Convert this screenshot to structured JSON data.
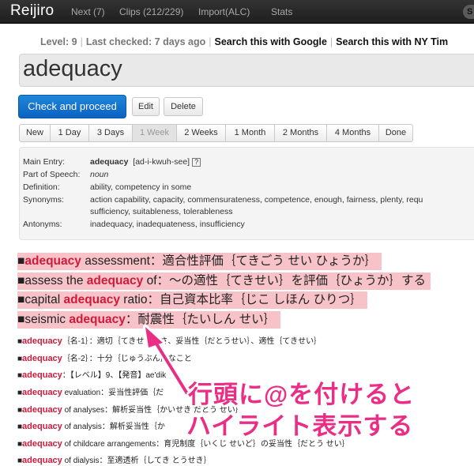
{
  "app": {
    "brand": "Reijiro",
    "nav": [
      {
        "label": "Next (7)"
      },
      {
        "label": "Clips (212/229)"
      },
      {
        "label": "Import(ALC)"
      },
      {
        "label": "Stats"
      }
    ],
    "user_badge": "S"
  },
  "info": {
    "level": "Level: 9",
    "last_checked": "Last checked: 7 days ago",
    "google": "Search this with Google",
    "nyt": "Search this with NY Tim"
  },
  "word": "adequacy",
  "actions": {
    "check": "Check and proceed",
    "edit": "Edit",
    "delete": "Delete"
  },
  "intervals": [
    "New",
    "1 Day",
    "3 Days",
    "1 Week",
    "2 Weeks",
    "1 Month",
    "2 Months",
    "4 Months",
    "Done"
  ],
  "active_interval": "1 Week",
  "definition": {
    "main_entry_label": "Main Entry:",
    "main_entry_word": "adequacy",
    "pronunciation": "[ad-i-kwuh-see]",
    "help": "?",
    "pos_label": "Part of Speech:",
    "pos": "noun",
    "def_label": "Definition:",
    "def": "ability, competency in some",
    "syn_label": "Synonyms:",
    "syn_line1": "action capability, capacity, commensurateness, competence, enough, fairness, plenty, requ",
    "syn_line2": "sufficiency, suitableness, tolerableness",
    "ant_label": "Antonyms:",
    "ant": "inadequacy, inadequateness, insufficiency"
  },
  "highlighted": [
    {
      "pre": "■",
      "kw": "adequacy",
      "post": " assessment：適合性評価｛てきごう せい ひょうか｝"
    },
    {
      "pre": "■assess the ",
      "kw": "adequacy",
      "post": " of：～の適性｛てきせい｝を評価｛ひょうか｝する"
    },
    {
      "pre": "■capital ",
      "kw": "adequacy",
      "post": " ratio：自己資本比率｛じこ しほん ひりつ｝"
    },
    {
      "pre": "■seismic ",
      "kw": "adequacy",
      "post": "：耐震性｛たいしん せい｝"
    }
  ],
  "entries": [
    {
      "pre": "■",
      "kw": "adequacy",
      "post": "｛名-1｝：適切｛てきせつ｝さ、妥当性｛だとうせい｝、適性｛てきせい｝"
    },
    {
      "pre": "■",
      "kw": "adequacy",
      "post": "｛名-2｝：十分｛じゅうぶん｝なこと"
    },
    {
      "pre": "■",
      "kw": "adequacy",
      "post": "：【レベル】9、【発音】ae'dik"
    },
    {
      "pre": "■",
      "kw": "adequacy",
      "post": " evaluation：妥当性評価｛だ"
    },
    {
      "pre": "■",
      "kw": "adequacy",
      "post": " of analyses：解析妥当性｛かいせき だとう せい｝"
    },
    {
      "pre": "■",
      "kw": "adequacy",
      "post": " of analysis：解析妥当性｛か"
    },
    {
      "pre": "■",
      "kw": "adequacy",
      "post": " of childcare arrangements：育児制度｛いくじ せいど｝の妥当性｛だとう せい｝"
    },
    {
      "pre": "■",
      "kw": "adequacy",
      "post": " of dialysis：至適透析｛してき とうせき｝"
    }
  ],
  "annotation": {
    "line1": "行頭に@を付けると",
    "line2": "ハイライト表示する",
    "color": "#ea2d85"
  },
  "colors": {
    "highlight_bg": "#f7c3c9",
    "keyword": "#d01a3c",
    "primary_button": "#0b62c2",
    "topbar": "#1e1e1e"
  }
}
